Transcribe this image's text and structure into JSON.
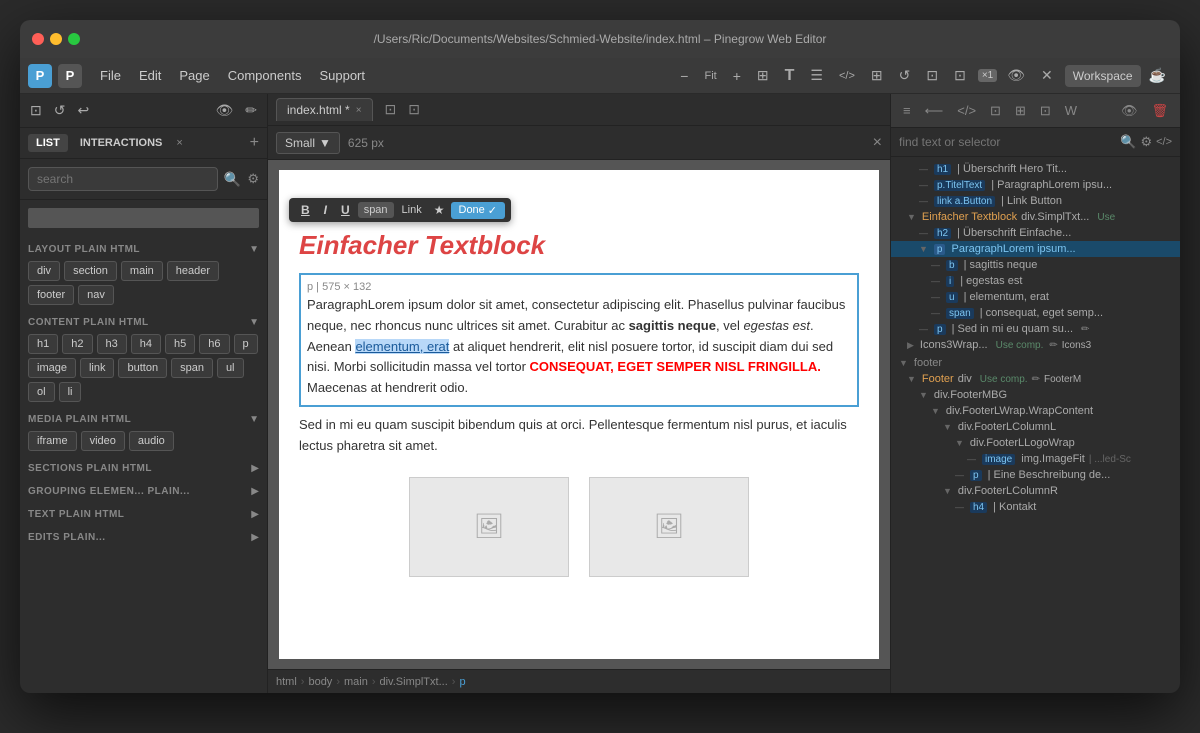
{
  "window": {
    "title": "/Users/Ric/Documents/Websites/Schmied-Website/index.html – Pinegrow Web Editor"
  },
  "traffic_lights": {
    "red": "●",
    "yellow": "●",
    "green": "●"
  },
  "menu": {
    "logo_p": "P",
    "logo_icon": "P",
    "items": [
      "File",
      "Edit",
      "Page",
      "Components",
      "Support"
    ],
    "toolbar_items": [
      "−",
      "Fit",
      "+",
      "⊞",
      "T",
      "☰",
      "</>",
      "⊞",
      "↺",
      "⊡",
      "⊡",
      "⊡"
    ],
    "workspace_label": "Workspace",
    "badge_count": "×1"
  },
  "sidebar": {
    "tab_list": "LIST",
    "tab_interactions": "INTERACTIONS",
    "tab_close": "×",
    "tab_add": "+",
    "search_placeholder": "search",
    "sections": [
      {
        "title": "LAYOUT Plain HTML",
        "elements": [
          "div",
          "section",
          "main",
          "header",
          "footer",
          "nav"
        ]
      },
      {
        "title": "CONTENT Plain HTML",
        "elements": [
          "h1",
          "h2",
          "h3",
          "h4",
          "h5",
          "h6",
          "p",
          "image",
          "link",
          "button",
          "span",
          "ul",
          "ol",
          "li"
        ]
      },
      {
        "title": "MEDIA Plain HTML",
        "elements": [
          "iframe",
          "video",
          "audio"
        ]
      },
      {
        "title": "SECTIONS Plain HTML",
        "elements": []
      },
      {
        "title": "GROUPING ELEMEN... Plain...",
        "elements": []
      },
      {
        "title": "TEXT Plain HTML",
        "elements": []
      },
      {
        "title": "EDITS Plain...",
        "elements": []
      }
    ]
  },
  "tabs": {
    "file_tab": "index.html",
    "file_tab_modified": "*",
    "actions": [
      "⊡",
      "⊡",
      "×"
    ]
  },
  "preview": {
    "device_label": "Small",
    "px_value": "625 px",
    "close_btn": "×"
  },
  "editor": {
    "toolbar": {
      "bold": "B",
      "italic": "I",
      "underline": "U",
      "span": "span",
      "link": "Link",
      "star": "★",
      "done": "Done",
      "done_check": "✓"
    },
    "heading": "Einfacher Textblock",
    "selected_para": {
      "text_before": "ParagraphLorem ipsum dolor sit amet, consectetur adipiscing elit. Phasellus pulvinar faucibus neque, nec rhoncus nunc ultrices sit amet. Curabitur ac ",
      "text_bold": "sagittis neque",
      "text_after_bold": ", vel ",
      "text_italic": "egestas est",
      "text_after_italic": ". Aenean ",
      "text_highlight": "elementum, erat",
      "text_after_highlight": " at aliquet hendrerit, elit nisl posuere tortor, id suscipit diam dui sed nisi. Morbi sollicitudin massa vel tortor ",
      "text_red": "CONSEQUAT, EGET SEMPER NISL FRINGILLA.",
      "text_after_red": " Maecenas at hendrerit odio.",
      "size_label": "p | 575 × 132"
    },
    "plain_para": "Sed in mi eu quam suscipit bibendum quis at orci. Pellentesque fermentum nisl purus, et iaculis lectus pharetra sit amet."
  },
  "breadcrumb": {
    "items": [
      "html",
      "body",
      "main",
      "div.SimplTxt...",
      "p"
    ]
  },
  "right_panel": {
    "toolbar_icons": [
      "≡",
      "⟵",
      "</>",
      "⊡",
      "⊡",
      "⊡",
      "W"
    ],
    "search_placeholder": "find text or selector",
    "tree": [
      {
        "indent": 2,
        "tag": "h1",
        "label": "| Überschrift Hero Tit...",
        "type": "normal"
      },
      {
        "indent": 2,
        "tag": "p.TitelText",
        "label": "| ParagraphLorem ipsu...",
        "type": "normal"
      },
      {
        "indent": 2,
        "tag": "link a.Button",
        "label": "| Link Button",
        "type": "normal"
      },
      {
        "indent": 1,
        "tag": "Einfacher Textblock",
        "label": "div.SimplTxt...",
        "use_label": "Use",
        "type": "section-parent"
      },
      {
        "indent": 2,
        "tag": "h2",
        "label": "| Überschrift Einfache...",
        "type": "normal"
      },
      {
        "indent": 2,
        "tag": "p",
        "label": "ParagraphLorem ipsum...",
        "type": "selected"
      },
      {
        "indent": 3,
        "tag": "b",
        "label": "| sagittis neque",
        "type": "normal"
      },
      {
        "indent": 3,
        "tag": "i",
        "label": "| egestas est",
        "type": "normal"
      },
      {
        "indent": 3,
        "tag": "u",
        "label": "| elementum, erat",
        "type": "normal"
      },
      {
        "indent": 3,
        "tag": "span",
        "label": "| consequat, eget semp...",
        "type": "normal"
      },
      {
        "indent": 2,
        "tag": "p",
        "label": "| Sed in mi eu quam su...",
        "type": "normal",
        "has_edit": true
      },
      {
        "indent": 1,
        "tag": "Icons3Wrap...",
        "label": "div.Icons3Wrap",
        "use_label": "Use comp.",
        "second_label": "Icons3",
        "type": "normal"
      },
      {
        "indent": 0,
        "tag": "footer",
        "label": "",
        "type": "section-label"
      },
      {
        "indent": 1,
        "tag": "Footer",
        "label": "div",
        "use_label": "Use comp.",
        "second_label": "FooterM",
        "type": "normal"
      },
      {
        "indent": 2,
        "tag": "div.FooterMBG",
        "label": "",
        "type": "normal"
      },
      {
        "indent": 3,
        "tag": "div.FooterLWrap.WrapContent",
        "label": "",
        "type": "normal"
      },
      {
        "indent": 4,
        "tag": "div.FooterLColumnL",
        "label": "",
        "type": "normal"
      },
      {
        "indent": 5,
        "tag": "div.FooterLLogoWrap",
        "label": "",
        "type": "normal"
      },
      {
        "indent": 6,
        "tag": "image",
        "label": "img.ImageFit",
        "extra": "| ...led-Sc",
        "type": "normal"
      },
      {
        "indent": 5,
        "tag": "p",
        "label": "| Eine Beschreibung de...",
        "type": "normal"
      },
      {
        "indent": 4,
        "tag": "div.FooterLColumnR",
        "label": "",
        "type": "normal"
      },
      {
        "indent": 5,
        "tag": "h4",
        "label": "| Kontakt",
        "type": "normal"
      }
    ]
  }
}
